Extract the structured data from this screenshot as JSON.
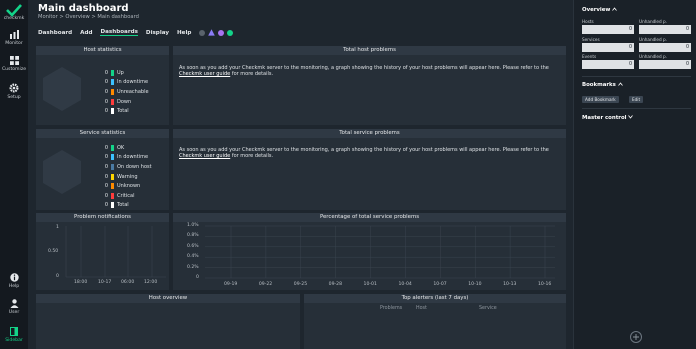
{
  "nav": {
    "logo_text": "checkmk",
    "items": [
      {
        "label": "Monitor",
        "icon": "monitor-icon"
      },
      {
        "label": "Customize",
        "icon": "customize-icon"
      },
      {
        "label": "Setup",
        "icon": "gear-icon"
      }
    ],
    "bottom_items": [
      {
        "label": "Help",
        "icon": "help-icon"
      },
      {
        "label": "User",
        "icon": "user-icon"
      },
      {
        "label": "Sidebar",
        "icon": "sidebar-icon"
      }
    ]
  },
  "header": {
    "title": "Main dashboard",
    "breadcrumb": "Monitor > Overview > Main dashboard",
    "menu": [
      "Dashboard",
      "Add",
      "Dashboards",
      "Display",
      "Help"
    ],
    "active_menu": "Dashboards",
    "menu_icons": [
      "status-icon",
      "warning-icon",
      "shield-icon",
      "spotify-icon"
    ]
  },
  "host_stats": {
    "title": "Host statistics",
    "rows": [
      {
        "count": "0",
        "label": "Up",
        "color": "#13d389"
      },
      {
        "count": "0",
        "label": "In downtime",
        "color": "#3cc2ff"
      },
      {
        "count": "0",
        "label": "Unreachable",
        "color": "#ff8a00"
      },
      {
        "count": "0",
        "label": "Down",
        "color": "#ff3c3c"
      },
      {
        "count": "0",
        "label": "Total",
        "color": "#ffffff"
      }
    ]
  },
  "host_problems": {
    "title": "Total host problems",
    "msg_pre": "As soon as you add your Checkmk server to the monitoring, a graph showing the history of your host problems will appear here. Please refer to the",
    "link": "Checkmk user guide",
    "msg_post": "for more details."
  },
  "service_stats": {
    "title": "Service statistics",
    "rows": [
      {
        "count": "0",
        "label": "OK",
        "color": "#13d389"
      },
      {
        "count": "0",
        "label": "In downtime",
        "color": "#3cc2ff"
      },
      {
        "count": "0",
        "label": "On down host",
        "color": "#4b7ba3"
      },
      {
        "count": "0",
        "label": "Warning",
        "color": "#ffd500"
      },
      {
        "count": "0",
        "label": "Unknown",
        "color": "#ff8a00"
      },
      {
        "count": "0",
        "label": "Critical",
        "color": "#ff3c3c"
      },
      {
        "count": "0",
        "label": "Total",
        "color": "#ffffff"
      }
    ]
  },
  "service_problems": {
    "title": "Total service problems",
    "msg_pre": "As soon as you add your Checkmk server to the monitoring, a graph showing the history of your host problems will appear here. Please refer to the",
    "link": "Checkmk user guide",
    "msg_post": "for more details."
  },
  "problem_notifications": {
    "title": "Problem notifications",
    "yticks": [
      "1",
      "0.50",
      "0"
    ],
    "xticks": [
      "18:00",
      "10-17",
      "06:00",
      "12:00"
    ]
  },
  "pct_service_problems": {
    "title": "Percentage of total service problems",
    "yticks": [
      "1.0%",
      "0.8%",
      "0.6%",
      "0.4%",
      "0.2%",
      "0"
    ],
    "xticks": [
      "09-19",
      "09-22",
      "09-25",
      "09-28",
      "10-01",
      "10-04",
      "10-07",
      "10-10",
      "10-13",
      "10-16"
    ]
  },
  "host_overview": {
    "title": "Host overview"
  },
  "top_alerters": {
    "title": "Top alerters (last 7 days)",
    "columns": [
      "Problems",
      "Host",
      "Service"
    ]
  },
  "sidebar": {
    "overview_title": "Overview",
    "overview": [
      {
        "label": "Hosts",
        "value": "0"
      },
      {
        "label": "Unhandled p.",
        "value": "0"
      },
      {
        "label": "Services",
        "value": "0"
      },
      {
        "label": "Unhandled p.",
        "value": "0"
      },
      {
        "label": "Events",
        "value": "0"
      },
      {
        "label": "Unhandled p.",
        "value": "0"
      }
    ],
    "bookmarks_title": "Bookmarks",
    "add_bookmark": "Add Bookmark",
    "edit": "Edit",
    "master_control_title": "Master control"
  },
  "colors": {
    "accent": "#13d389",
    "background": "#1e262e",
    "panel": "#262f38"
  }
}
